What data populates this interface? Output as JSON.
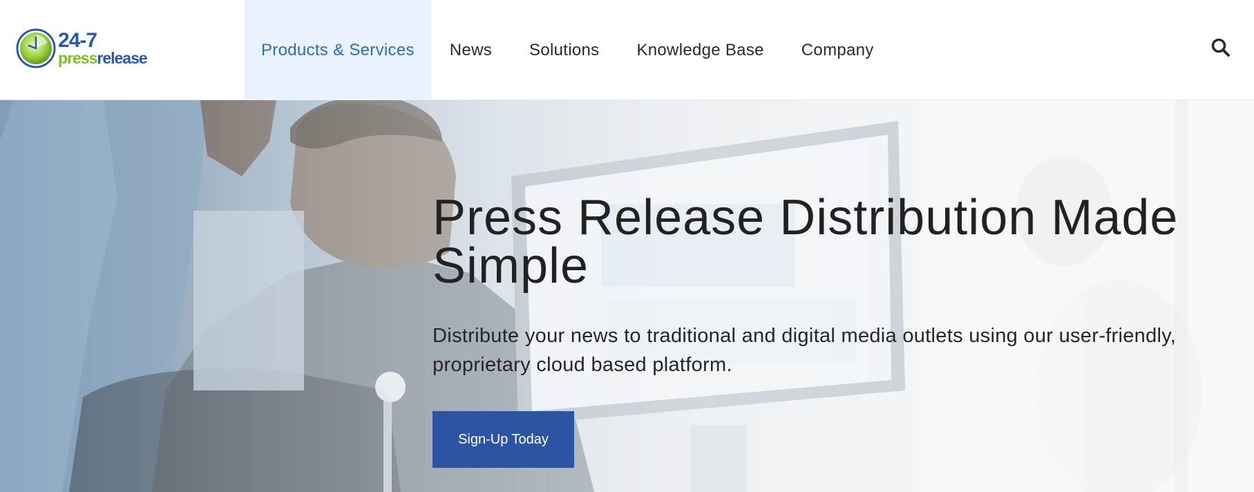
{
  "logo": {
    "top_text": "24-7",
    "bottom_press": "press",
    "bottom_release": "release"
  },
  "nav": {
    "items": [
      {
        "label": "Products & Services",
        "active": true
      },
      {
        "label": "News"
      },
      {
        "label": "Solutions"
      },
      {
        "label": "Knowledge Base"
      },
      {
        "label": "Company"
      }
    ]
  },
  "icons": {
    "search": "search-icon",
    "logo": "clock-logo-icon"
  },
  "hero": {
    "title": "Press Release Distribution Made Simple",
    "subtitle": "Distribute your news to traditional and digital media outlets using our user-friendly, proprietary cloud based platform.",
    "cta_label": "Sign-Up Today"
  },
  "colors": {
    "brand_blue": "#2b59a8",
    "brand_green": "#7cbf2c",
    "nav_active_bg": "#e9f1fd",
    "nav_active_text": "#2f6eb0",
    "cta_bg": "#2c54a3"
  }
}
